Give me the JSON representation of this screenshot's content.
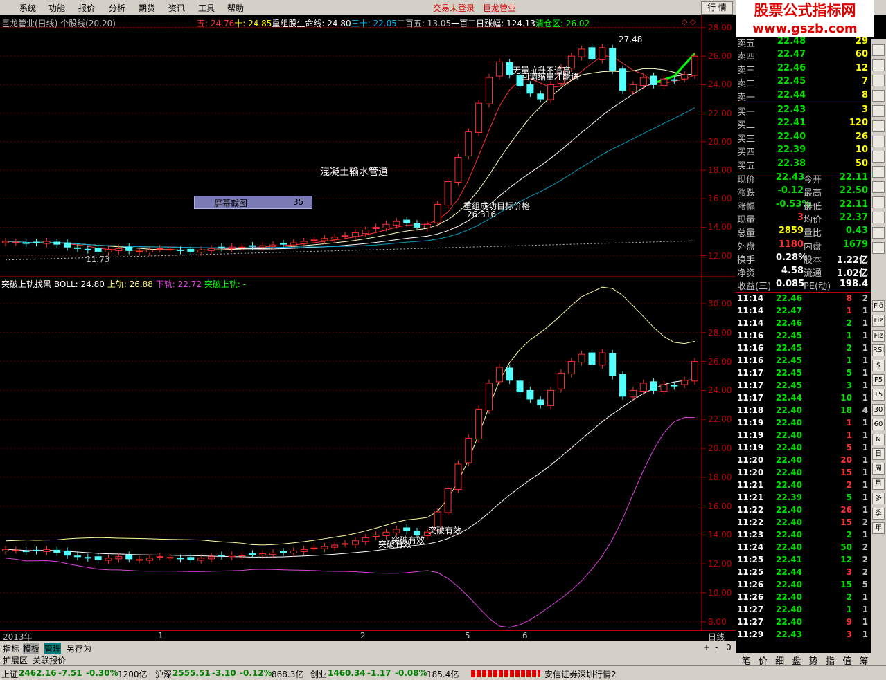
{
  "menu": {
    "items": [
      "系统",
      "功能",
      "报价",
      "分析",
      "期货",
      "资讯",
      "工具",
      "帮助"
    ],
    "login": "交易未登录",
    "stock_link": "巨龙管业",
    "hq_button": "行 情"
  },
  "watermark": {
    "line1": "股票公式指标网",
    "line2": "www.gszb.com"
  },
  "chart": {
    "title": "巨龙管业(日线) 个股线(20,20)",
    "ma": [
      {
        "label": "五: 24.76",
        "color": "#ff3030"
      },
      {
        "label": "十: 24.85",
        "color": "#ffff00"
      },
      {
        "label": "重组股生命线: 24.80",
        "color": "#ffffff"
      },
      {
        "label": "三十: 22.05",
        "color": "#00c0ff"
      },
      {
        "label": "二百五: 13.05",
        "color": "#c0c0c0"
      },
      {
        "label": "一百二日涨幅: 124.13",
        "color": "#ffffff"
      },
      {
        "label": "清仓区: 26.02",
        "color": "#00ff00"
      }
    ],
    "ann_concrete": "混凝土输水管道",
    "ann_screenshot_label": "屏幕截图",
    "ann_screenshot_value": "35",
    "ann_target": "重组成功目标价格",
    "ann_target_value": "26.316",
    "ann_high_value": "27.48",
    "ann_low_value": "11.73",
    "ann_no_chase": "无量拉升不追高",
    "ann_wait": "回调缩量才能进",
    "bottom_title": "突破上轨找黑",
    "bottom_boll": "BOLL: 24.80",
    "bottom_upper": "上轨: 26.88",
    "bottom_lower": "下轨: 22.72",
    "bottom_break": "突破上轨: -",
    "ann_break1": "突破有效",
    "ann_break2": "突破有效",
    "ann_break3": "突破有效",
    "upper_axis": [
      "28.00",
      "26.00",
      "24.00",
      "22.00",
      "20.00",
      "18.00",
      "16.00",
      "14.00",
      "12.00"
    ],
    "lower_axis": [
      "30.00",
      "28.00",
      "26.00",
      "24.00",
      "22.00",
      "20.00",
      "18.00",
      "16.00",
      "14.00",
      "12.00",
      "10.00",
      "8.00"
    ],
    "date_axis": [
      "2013年",
      "1",
      "2",
      "5",
      "6"
    ],
    "period_label": "日线"
  },
  "chart_data": {
    "type": "candlestick",
    "ylim_upper": [
      11,
      29
    ],
    "ylim_lower": [
      7,
      32
    ],
    "close": [
      13.0,
      12.95,
      12.85,
      12.9,
      13.0,
      12.8,
      12.6,
      12.5,
      12.4,
      12.3,
      12.4,
      12.5,
      12.35,
      12.3,
      12.4,
      12.5,
      12.45,
      12.35,
      12.3,
      12.4,
      12.5,
      12.55,
      12.6,
      12.6,
      12.65,
      12.7,
      12.75,
      12.8,
      12.9,
      13.0,
      13.1,
      13.2,
      13.3,
      13.4,
      13.6,
      13.8,
      14.0,
      14.2,
      14.4,
      14.3,
      14.0,
      14.2,
      15.6,
      17.2,
      18.9,
      20.7,
      22.7,
      24.5,
      25.6,
      24.7,
      23.9,
      23.4,
      23.0,
      24.0,
      25.2,
      26.0,
      26.5,
      25.8,
      26.6,
      25.0,
      23.6,
      24.0,
      24.5,
      24.0,
      24.4,
      24.3,
      24.7,
      26.0
    ]
  },
  "quote": {
    "asks": [
      {
        "label": "卖五",
        "price": "22.48",
        "vol": "29"
      },
      {
        "label": "卖四",
        "price": "22.47",
        "vol": "60"
      },
      {
        "label": "卖三",
        "price": "22.46",
        "vol": "12"
      },
      {
        "label": "卖二",
        "price": "22.45",
        "vol": "7"
      },
      {
        "label": "卖一",
        "price": "22.44",
        "vol": "8"
      }
    ],
    "bids": [
      {
        "label": "买一",
        "price": "22.43",
        "vol": "3"
      },
      {
        "label": "买二",
        "price": "22.41",
        "vol": "120"
      },
      {
        "label": "买三",
        "price": "22.40",
        "vol": "26"
      },
      {
        "label": "买四",
        "price": "22.39",
        "vol": "10"
      },
      {
        "label": "买五",
        "price": "22.38",
        "vol": "50"
      }
    ],
    "stats": [
      {
        "l1": "现价",
        "v1": "22.43",
        "c1": "#00e000",
        "l2": "今开",
        "v2": "22.11",
        "c2": "#00e000"
      },
      {
        "l1": "涨跌",
        "v1": "-0.12",
        "c1": "#00e000",
        "l2": "最高",
        "v2": "22.50",
        "c2": "#00e000"
      },
      {
        "l1": "涨幅",
        "v1": "-0.53%",
        "c1": "#00e000",
        "l2": "最低",
        "v2": "22.11",
        "c2": "#00e000"
      },
      {
        "l1": "现量",
        "v1": "3",
        "c1": "#ff3030",
        "l2": "均价",
        "v2": "22.37",
        "c2": "#00e000"
      },
      {
        "l1": "总量",
        "v1": "2859",
        "c1": "#ffff00",
        "l2": "量比",
        "v2": "0.43",
        "c2": "#00e000"
      },
      {
        "l1": "外盘",
        "v1": "1180",
        "c1": "#ff3030",
        "l2": "内盘",
        "v2": "1679",
        "c2": "#00e000"
      },
      {
        "l1": "换手",
        "v1": "0.28%",
        "c1": "#ffffff",
        "l2": "股本",
        "v2": "1.22亿",
        "c2": "#ffffff"
      },
      {
        "l1": "净资",
        "v1": "4.58",
        "c1": "#ffffff",
        "l2": "流通",
        "v2": "1.02亿",
        "c2": "#ffffff"
      },
      {
        "l1": "收益(三)",
        "v1": "0.085",
        "c1": "#ffffff",
        "l2": "PE(动)",
        "v2": "198.4",
        "c2": "#ffffff"
      }
    ],
    "trades": [
      {
        "t": "11:14",
        "p": "22.46",
        "v": "8",
        "n": "2",
        "c": "#ff3030"
      },
      {
        "t": "11:14",
        "p": "22.47",
        "v": "1",
        "n": "1",
        "c": "#ff3030"
      },
      {
        "t": "11:14",
        "p": "22.46",
        "v": "2",
        "n": "1",
        "c": "#00e000"
      },
      {
        "t": "11:16",
        "p": "22.45",
        "v": "1",
        "n": "1",
        "c": "#00e000"
      },
      {
        "t": "11:16",
        "p": "22.45",
        "v": "2",
        "n": "1",
        "c": "#00e000"
      },
      {
        "t": "11:16",
        "p": "22.45",
        "v": "1",
        "n": "1",
        "c": "#00e000"
      },
      {
        "t": "11:17",
        "p": "22.45",
        "v": "5",
        "n": "1",
        "c": "#00e000"
      },
      {
        "t": "11:17",
        "p": "22.45",
        "v": "3",
        "n": "1",
        "c": "#00e000"
      },
      {
        "t": "11:17",
        "p": "22.44",
        "v": "10",
        "n": "1",
        "c": "#00e000"
      },
      {
        "t": "11:18",
        "p": "22.40",
        "v": "18",
        "n": "4",
        "c": "#00e000"
      },
      {
        "t": "11:19",
        "p": "22.40",
        "v": "1",
        "n": "1",
        "c": "#ff3030"
      },
      {
        "t": "11:19",
        "p": "22.40",
        "v": "1",
        "n": "1",
        "c": "#ff3030"
      },
      {
        "t": "11:19",
        "p": "22.40",
        "v": "5",
        "n": "1",
        "c": "#ff3030"
      },
      {
        "t": "11:20",
        "p": "22.40",
        "v": "20",
        "n": "1",
        "c": "#ff3030"
      },
      {
        "t": "11:20",
        "p": "22.40",
        "v": "15",
        "n": "1",
        "c": "#ff3030"
      },
      {
        "t": "11:21",
        "p": "22.40",
        "v": "2",
        "n": "1",
        "c": "#ff3030"
      },
      {
        "t": "11:21",
        "p": "22.39",
        "v": "5",
        "n": "1",
        "c": "#00e000"
      },
      {
        "t": "11:22",
        "p": "22.40",
        "v": "26",
        "n": "1",
        "c": "#ff3030"
      },
      {
        "t": "11:22",
        "p": "22.40",
        "v": "15",
        "n": "2",
        "c": "#ff3030"
      },
      {
        "t": "11:23",
        "p": "22.40",
        "v": "2",
        "n": "1",
        "c": "#00e000"
      },
      {
        "t": "11:24",
        "p": "22.40",
        "v": "50",
        "n": "2",
        "c": "#00e000"
      },
      {
        "t": "11:25",
        "p": "22.41",
        "v": "12",
        "n": "2",
        "c": "#00e000"
      },
      {
        "t": "11:25",
        "p": "22.44",
        "v": "3",
        "n": "2",
        "c": "#ff3030"
      },
      {
        "t": "11:26",
        "p": "22.40",
        "v": "15",
        "n": "5",
        "c": "#00e000"
      },
      {
        "t": "11:26",
        "p": "22.40",
        "v": "2",
        "n": "1",
        "c": "#00e000"
      },
      {
        "t": "11:27",
        "p": "22.40",
        "v": "1",
        "n": "1",
        "c": "#00e000"
      },
      {
        "t": "11:27",
        "p": "22.40",
        "v": "9",
        "n": "1",
        "c": "#ff3030"
      },
      {
        "t": "11:29",
        "p": "22.43",
        "v": "3",
        "n": "1",
        "c": "#ff3030"
      }
    ]
  },
  "right_tabs": [
    "笔",
    "价",
    "细",
    "盘",
    "势",
    "指",
    "值",
    "筹"
  ],
  "bottom_tabs": {
    "row1": [
      "指标",
      "模板",
      "管理",
      "另存为"
    ],
    "row2": [
      "扩展区",
      "关联报价"
    ],
    "controls": [
      "+",
      "-",
      "0"
    ]
  },
  "toolbar_icons": [
    "Fiō",
    "Fiz",
    "Fiz",
    "RSI",
    "$",
    "F5",
    "15",
    "30",
    "60",
    "N",
    "日",
    "周",
    "月",
    "多",
    "季",
    "年"
  ],
  "status": [
    {
      "name": "上证",
      "price": "2462.16",
      "chg": "-7.51",
      "pct": "-0.30%",
      "amt": "1200亿"
    },
    {
      "name": "沪深",
      "price": "2555.51",
      "chg": "-3.10",
      "pct": "-0.12%",
      "amt": "868.3亿"
    },
    {
      "name": "创业",
      "price": "1460.34",
      "chg": "-1.17",
      "pct": "-0.08%",
      "amt": "185.4亿"
    }
  ],
  "status_broker": "安信证券深圳行情2"
}
